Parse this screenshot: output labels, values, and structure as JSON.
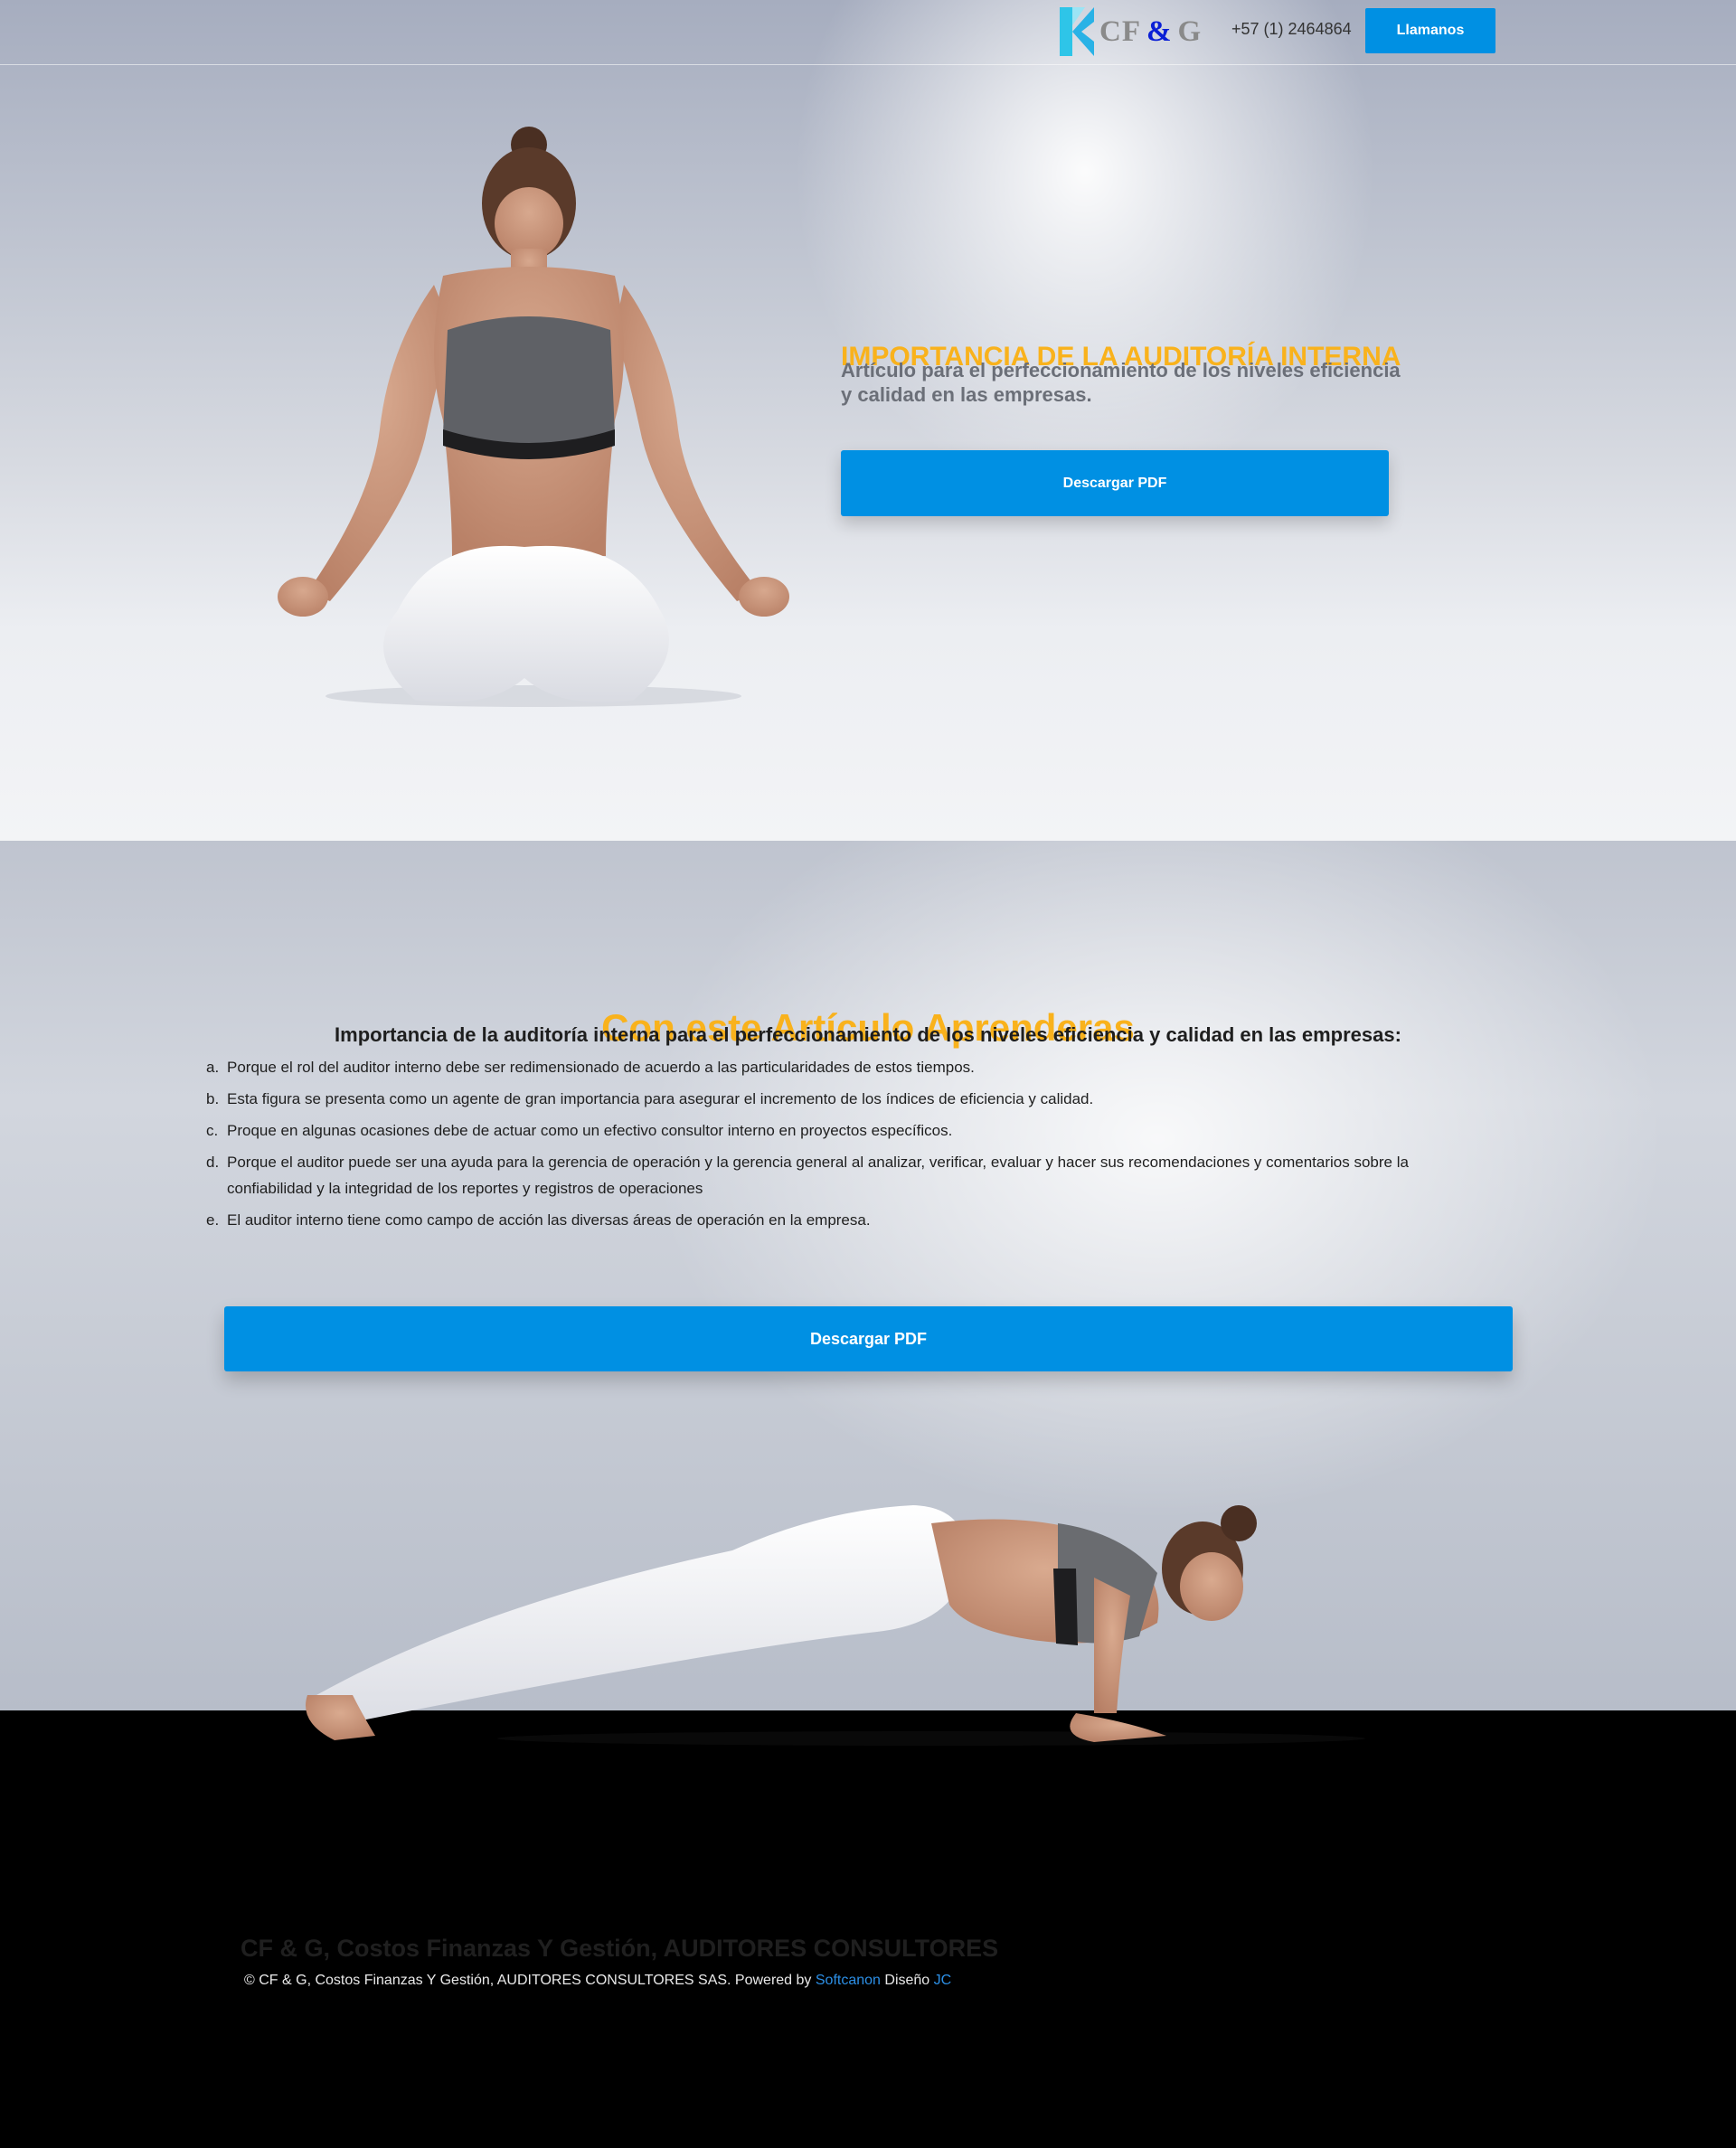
{
  "header": {
    "logo": {
      "cf": "CF",
      "amp": "&",
      "g": "G"
    },
    "phone": "+57 (1) 2464864",
    "call_button": "Llamanos"
  },
  "hero": {
    "title": "IMPORTANCIA DE LA AUDITORÍA INTERNA",
    "subtitle": "Artículo para el perfeccionamiento de los niveles eficiencia y calidad en las empresas.",
    "download_button": "Descargar PDF"
  },
  "article": {
    "title": "Con este Artículo Aprenderas",
    "subtitle": "Importancia de la auditoría interna para el perfeccionamiento de los niveles eficiencia y calidad en las empresas:",
    "items": [
      {
        "letter": "a.",
        "text": "Porque el rol del auditor interno debe ser redimensionado de acuerdo a las particularidades de estos tiempos."
      },
      {
        "letter": "b.",
        "text": "Esta figura se presenta como un agente de gran importancia para asegurar el incremento de los índices de eficiencia y calidad."
      },
      {
        "letter": "c.",
        "text": "Proque en algunas ocasiones debe de actuar como un efectivo consultor interno en proyectos específicos."
      },
      {
        "letter": "d.",
        "text": "Porque el auditor puede ser una ayuda para la gerencia de operación y la gerencia general al analizar, verificar, evaluar y hacer sus recomendaciones y comentarios sobre la confiabilidad y la integridad de los reportes y registros de operaciones"
      },
      {
        "letter": "e.",
        "text": "El auditor interno tiene como campo de acción las diversas áreas de operación en la empresa."
      }
    ],
    "download_button": "Descargar PDF"
  },
  "footer": {
    "title": "CF & G, Costos Finanzas Y Gestión, AUDITORES CONSULTORES",
    "copyright": "© CF & G, Costos Finanzas Y Gestión, AUDITORES CONSULTORES SAS.  Powered by",
    "powered_link": "Softcanon",
    "design_label": "Diseño",
    "design_link": "JC"
  },
  "colors": {
    "accent_blue": "#0090e3",
    "title_yellow": "#f9b21c",
    "link_blue": "#2c8fe6"
  }
}
